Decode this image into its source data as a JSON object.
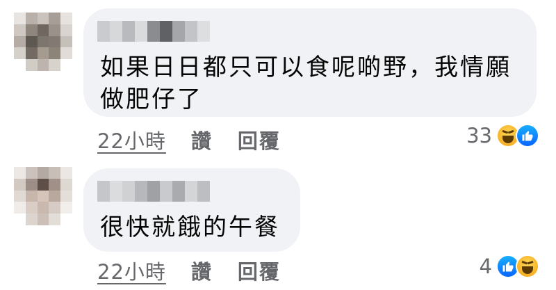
{
  "comments": [
    {
      "text": "如果日日都只可以食呢啲野，我情願做肥仔了",
      "time": "22小時",
      "like_label": "讚",
      "reply_label": "回覆",
      "reaction_count": "33",
      "reactions": [
        "haha-icon",
        "like-icon"
      ]
    },
    {
      "text": "很快就餓的午餐",
      "time": "22小時",
      "like_label": "讚",
      "reply_label": "回覆",
      "reaction_count": "4",
      "reactions": [
        "like-icon",
        "haha-icon"
      ]
    }
  ],
  "colors": {
    "bubble": "#f0f2f5",
    "meta_text": "#65676b",
    "like_blue": "#0866ff",
    "haha_yellow": "#f7b125"
  }
}
